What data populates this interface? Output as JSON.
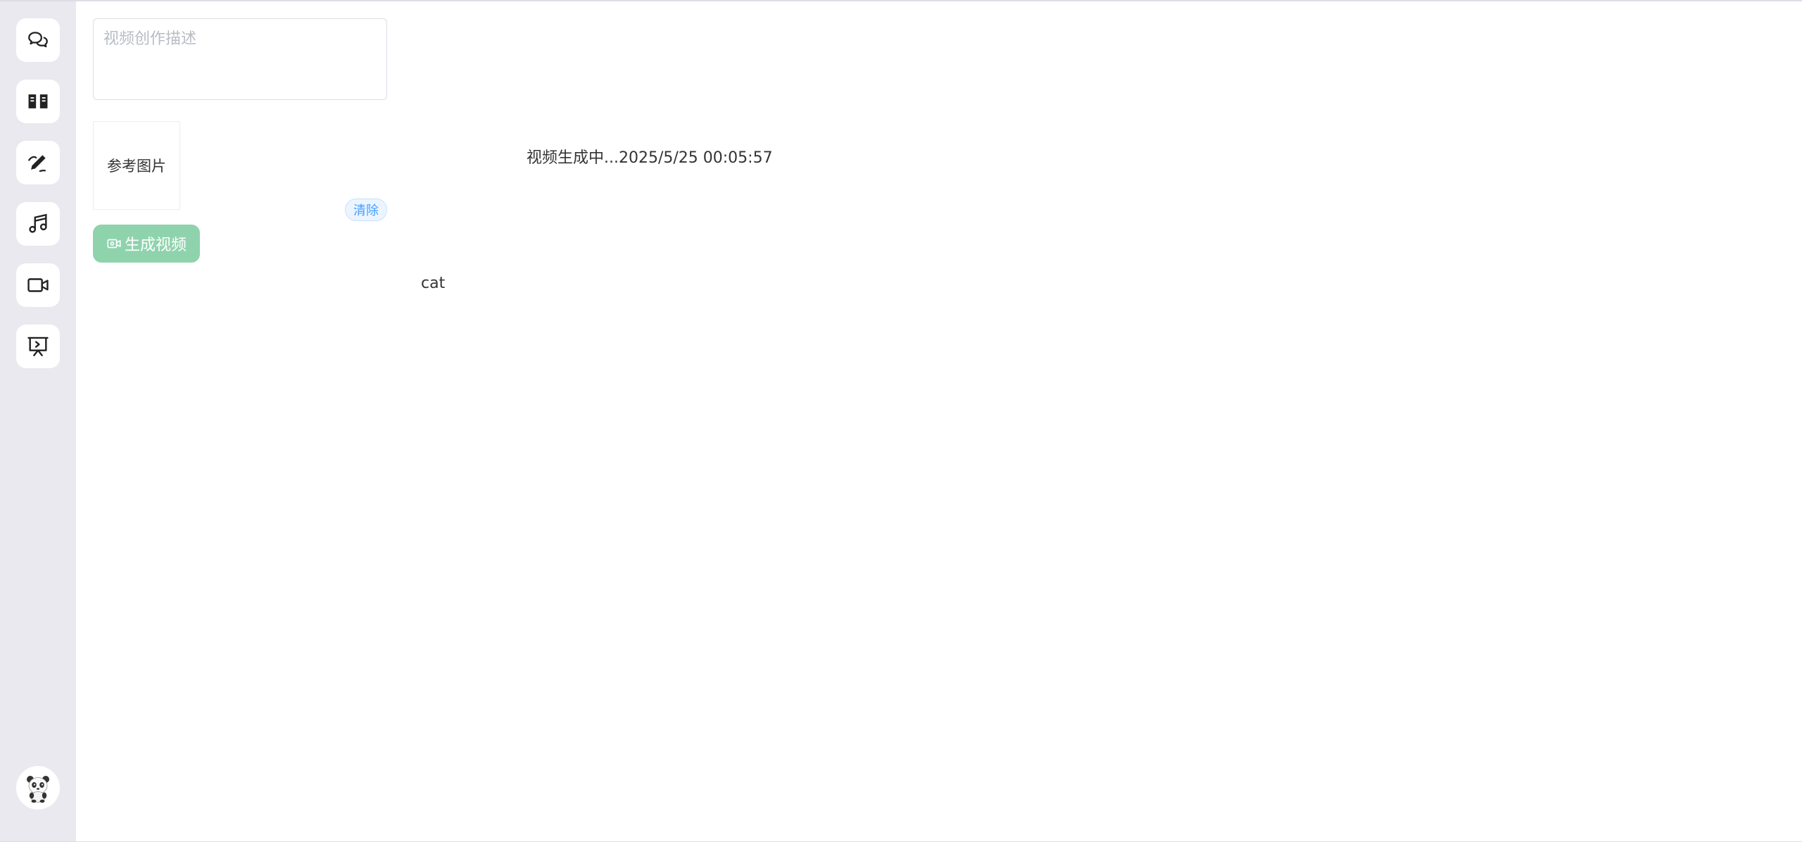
{
  "sidebar": {
    "items": [
      {
        "icon": "chat-bubbles-icon",
        "label": ""
      },
      {
        "icon": "open-book-icon",
        "label": ""
      },
      {
        "icon": "pen-edit-icon",
        "label": ""
      },
      {
        "icon": "music-note-icon",
        "label": ""
      },
      {
        "icon": "video-camera-icon",
        "label": ""
      },
      {
        "icon": "presentation-board-icon",
        "label": ""
      }
    ],
    "avatar_icon": "panda-avatar-icon"
  },
  "form": {
    "description_placeholder": "视频创作描述",
    "description_value": "",
    "reference_image_label": "参考图片",
    "clear_label": "清除",
    "generate_label": "生成视频"
  },
  "output": {
    "status": "视频生成中...2025/5/25 00:05:57",
    "prompt": "cat"
  },
  "colors": {
    "sidebar_bg": "#e9e9ef",
    "generate_button": "#8fd3ad",
    "clear_button_text": "#409eff"
  }
}
